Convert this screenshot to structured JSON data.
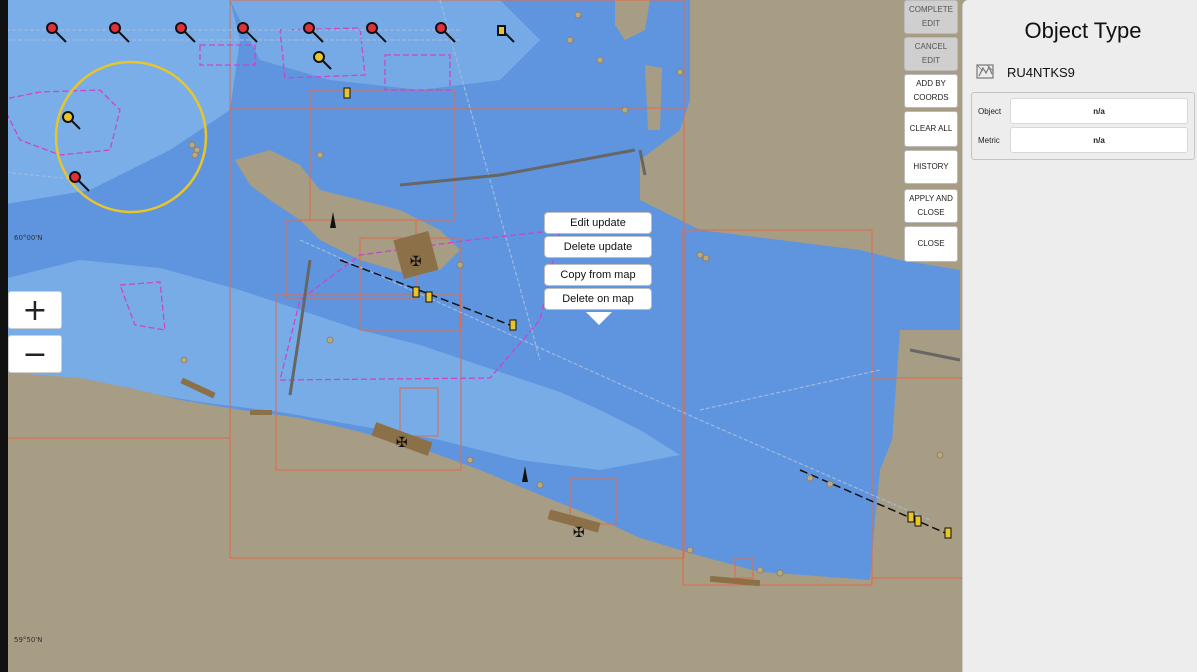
{
  "colors": {
    "deep_water": "#5f95df",
    "shallow_water": "#7aaee8",
    "land": "#a79c84",
    "cell_outline": "#e06a4a",
    "restricted_area": "#cc44cc",
    "buoy_red": "#e0303a",
    "buoy_yellow": "#e8c52a",
    "panel_bg": "#ededed"
  },
  "map": {
    "lat_labels": [
      "60°00'N",
      "59°50'N"
    ],
    "zoom_in_label": "+",
    "zoom_out_label": "−"
  },
  "toolbar": {
    "buttons": [
      {
        "label": "COMPLETE\nEDIT",
        "enabled": false
      },
      {
        "label": "CANCEL\nEDIT",
        "enabled": false
      },
      {
        "label": "ADD BY\nCOORDS",
        "enabled": true
      },
      {
        "label": "CLEAR ALL",
        "enabled": true
      },
      {
        "label": "HISTORY",
        "enabled": true
      },
      {
        "label": "APPLY AND\nCLOSE",
        "enabled": true
      },
      {
        "label": "CLOSE",
        "enabled": true
      }
    ]
  },
  "context_menu": {
    "items": [
      "Edit update",
      "Delete update",
      "Copy from map",
      "Delete on map"
    ]
  },
  "panel": {
    "title": "Object Type",
    "object_icon": "chart-cell-icon",
    "object_name": "RU4NTKS9",
    "fields": [
      {
        "label": "Object",
        "value": "n/a"
      },
      {
        "label": "Metric",
        "value": "n/a"
      }
    ]
  }
}
